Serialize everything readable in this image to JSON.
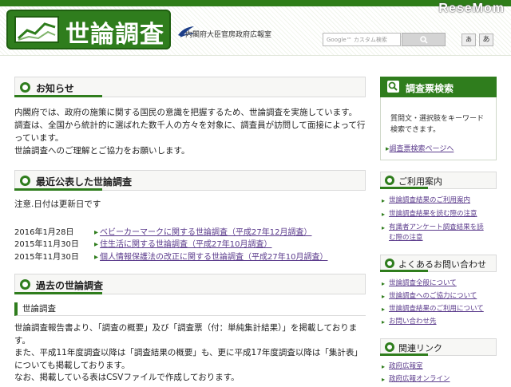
{
  "header": {
    "logo_text": "世論調査",
    "office": "内閣府大臣官房政府広報室",
    "search_placeholder": "Google™ カスタム検索",
    "font_small": "あ",
    "font_large": "あ",
    "watermark": "ReseMom"
  },
  "notice": {
    "title": "お知らせ",
    "lines": [
      "内閣府では、政府の施策に関する国民の意識を把握するため、世論調査を実施しています。",
      "調査は、全国から統計的に選ばれた数千人の方々を対象に、調査員が訪問して面接によって行",
      "っています。",
      "世論調査へのご理解とご協力をお願いします。"
    ]
  },
  "recent": {
    "title": "最近公表した世論調査",
    "note": "注意.日付は更新日です",
    "items": [
      {
        "date": "2016年1月28日",
        "label": "ベビーカーマークに関する世論調査（平成27年12月調査）"
      },
      {
        "date": "2015年11月30日",
        "label": "住生活に関する世論調査（平成27年10月調査）"
      },
      {
        "date": "2015年11月30日",
        "label": "個人情報保護法の改正に関する世論調査（平成27年10月調査）"
      }
    ]
  },
  "past": {
    "title": "過去の世論調査",
    "subsection": "世論調査",
    "lines": [
      "世論調査報告書より、「調査の概要」及び「調査票（付：単純集計結果）」を掲載しておりま",
      "す。",
      "また、平成11年度調査以降は「調査結果の概要」も、更に平成17年度調査以降は「集計表」",
      "についても掲載しております。",
      "なお、掲載している表はCSVファイルで作成しております。"
    ]
  },
  "sidebar": {
    "search_title": "調査票検索",
    "search_desc": [
      "質問文・選択肢をキーワード",
      "検索できます。"
    ],
    "search_link": "調査票検索ページへ",
    "guide_title": "ご利用案内",
    "guide_links": [
      "世論調査結果のご利用案内",
      "世論調査結果を読む際の注意",
      "有識者アンケート調査結果を読",
      "む際の注意"
    ],
    "faq_title": "よくあるお問い合わせ",
    "faq_links": [
      "世論調査全般について",
      "世論調査へのご協力について",
      "世論調査結果のご利用について",
      "お問い合わせ先"
    ],
    "related_title": "関連リンク",
    "related_links": [
      "政府広報室",
      "政府広報オンライン"
    ]
  },
  "colors": {
    "brand_green": "#2f7d1d",
    "link_purple": "#5b3b8c"
  }
}
